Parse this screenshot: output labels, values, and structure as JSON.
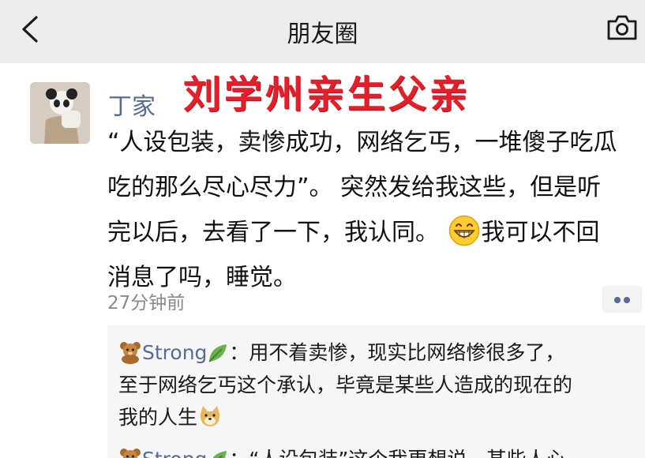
{
  "nav": {
    "title": "朋友圈"
  },
  "overlay_text": "刘学州亲生父亲",
  "post": {
    "user": "丁家",
    "text_lines": [
      "“人设包装，卖惨成功，网络乞丐，一堆傻子吃瓜",
      "吃的那么尽心尽力”。 突然发给我这些，但是听",
      "完以后，去看了一下，我认同。 ",
      "我可以不回",
      "消息了吗，睡觉。"
    ],
    "time": "27分钟前"
  },
  "comments": [
    {
      "name": "Strong",
      "lines": [
        "：用不着卖惨，现实比网络惨很多了，",
        "至于网络乞丐这个承认，毕竟是某些人造成的现在的",
        "我的人生"
      ]
    },
    {
      "name": "Strong",
      "text": "：“人设包装”这个我更想说，某些人心"
    }
  ],
  "icons": {
    "back": "back-chevron-icon",
    "camera": "camera-icon",
    "grin": "grinning-emoji-icon",
    "bear": "teddy-bear-emoji-icon",
    "leaf": "leaf-emoji-icon",
    "doge": "doge-emoji-icon",
    "more": "more-dots-icon"
  },
  "colors": {
    "link_blue": "#576b95",
    "overlay_red": "#e61e2a",
    "nav_bg": "#ededed",
    "comment_bg": "#f6f6f6"
  }
}
